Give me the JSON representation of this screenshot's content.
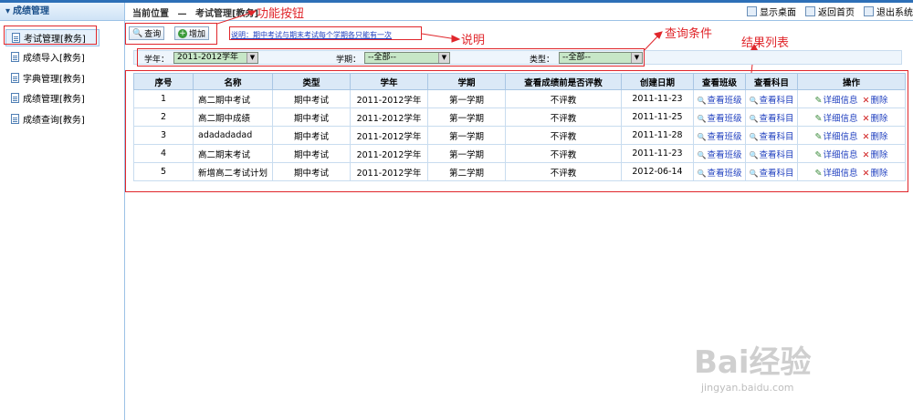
{
  "header": {
    "breadcrumb_label": "当前位置",
    "breadcrumb_sep": "—",
    "breadcrumb_page": "考试管理[教务]",
    "links": [
      "显示桌面",
      "返回首页",
      "退出系统"
    ]
  },
  "sidebar": {
    "title": "成绩管理",
    "items": [
      "考试管理[教务]",
      "成绩导入[教务]",
      "字典管理[教务]",
      "成绩管理[教务]",
      "成绩查询[教务]"
    ]
  },
  "toolbar": {
    "query_label": "查询",
    "add_label": "增加"
  },
  "note": "说明：期中考试与期末考试每个学期各只能有一次",
  "annotations": {
    "function_buttons": "功能按钮",
    "explanation": "说明",
    "query_conditions": "查询条件",
    "result_list": "结果列表"
  },
  "filters": {
    "year_label": "学年：",
    "year_value": "2011-2012学年",
    "term_label": "学期：",
    "term_value": "--全部--",
    "type_label": "类型：",
    "type_value": "--全部--"
  },
  "table": {
    "headers": [
      "序号",
      "名称",
      "类型",
      "学年",
      "学期",
      "查看成绩前是否评教",
      "创建日期",
      "查看班级",
      "查看科目",
      "操作"
    ],
    "rows": [
      [
        "1",
        "高二期中考试",
        "期中考试",
        "2011-2012学年",
        "第一学期",
        "不评教",
        "2011-11-23"
      ],
      [
        "2",
        "高二期中成绩",
        "期中考试",
        "2011-2012学年",
        "第一学期",
        "不评教",
        "2011-11-25"
      ],
      [
        "3",
        "adadadadad",
        "期中考试",
        "2011-2012学年",
        "第一学期",
        "不评教",
        "2011-11-28"
      ],
      [
        "4",
        "高二期末考试",
        "期中考试",
        "2011-2012学年",
        "第一学期",
        "不评教",
        "2011-11-23"
      ],
      [
        "5",
        "新增高二考试计划",
        "期中考试",
        "2011-2012学年",
        "第二学期",
        "不评教",
        "2012-06-14"
      ]
    ],
    "view_class_label": "查看班级",
    "view_subject_label": "查看科目",
    "detail_label": "详细信息",
    "delete_label": "删除"
  },
  "watermark": {
    "logo": "Bai经验",
    "url": "jingyan.baidu.com"
  },
  "colors": {
    "annotation_red": "#e0262b",
    "header_blue": "#2d6fb7",
    "link_blue": "#1f3fbf",
    "select_green": "#c7e7c7"
  }
}
